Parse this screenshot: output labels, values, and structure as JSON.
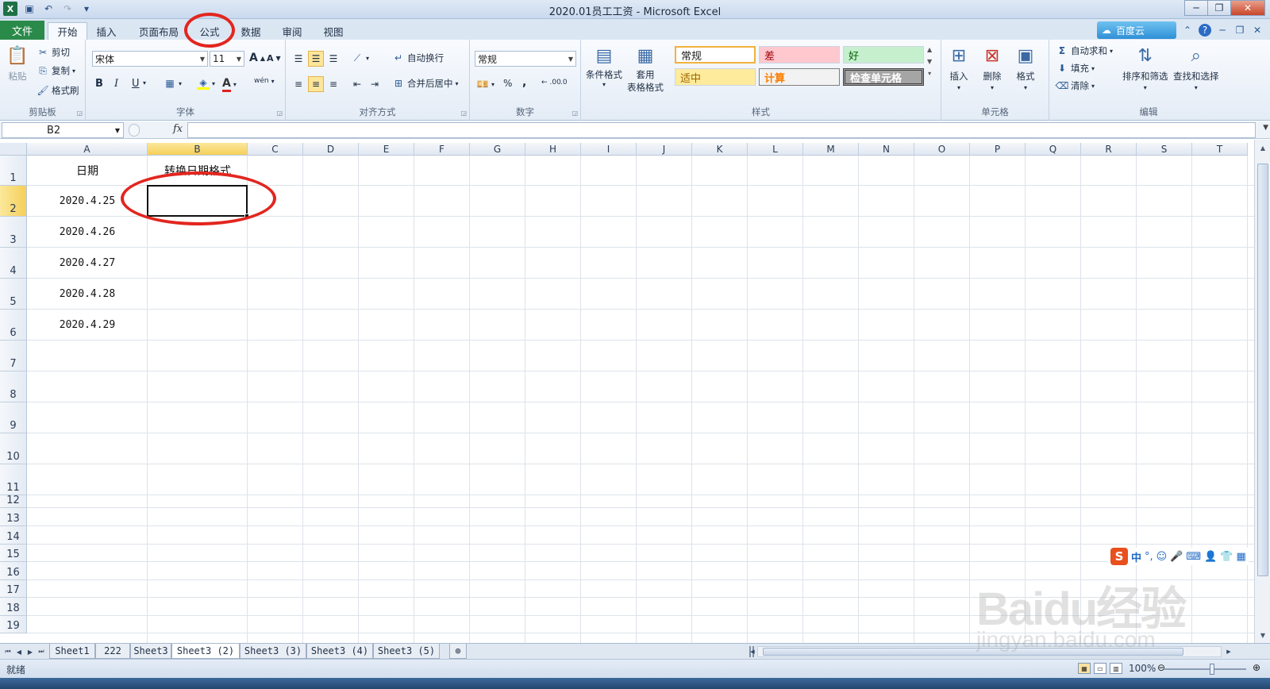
{
  "window": {
    "title": "2020.01员工工资 - Microsoft Excel",
    "controls": {
      "minimize": "─",
      "restore": "❐",
      "close": "✕"
    }
  },
  "ribbon_tabs": {
    "file": "文件",
    "tabs": [
      "开始",
      "插入",
      "页面布局",
      "公式",
      "数据",
      "审阅",
      "视图"
    ],
    "active": "开始",
    "cloud_label": "百度云"
  },
  "clipboard": {
    "paste": "粘贴",
    "cut": "剪切",
    "copy": "复制",
    "format_painter": "格式刷",
    "label": "剪贴板"
  },
  "font": {
    "name": "宋体",
    "size": "11",
    "bold": "B",
    "italic": "I",
    "underline": "U",
    "grow": "A",
    "shrink": "A",
    "color_a": "A",
    "wen": "wén",
    "label": "字体"
  },
  "alignment": {
    "wrap": "自动换行",
    "merge": "合并后居中",
    "label": "对齐方式"
  },
  "number": {
    "format": "常规",
    "percent": "%",
    "comma": ",",
    "inc_dec": ".00",
    "dec_dec": ".0",
    "label": "数字"
  },
  "styles": {
    "conditional": "条件格式",
    "table_format_1": "套用",
    "table_format_2": "表格格式",
    "normal": "常规",
    "bad": "差",
    "good": "好",
    "neutral": "适中",
    "calc": "计算",
    "check": "检查单元格",
    "label": "样式",
    "colors": {
      "normal": "#ffffff",
      "bad": "#ffc7ce",
      "good": "#c6efce",
      "neutral": "#ffeb9c",
      "calc": "#f2f2f2",
      "check": "#a5a5a5"
    }
  },
  "cells": {
    "insert": "插入",
    "delete": "删除",
    "format": "格式",
    "label": "单元格"
  },
  "editing": {
    "autosum": "自动求和",
    "fill": "填充",
    "clear": "清除",
    "sort": "排序和筛选",
    "find": "查找和选择",
    "label": "编辑"
  },
  "formula_bar": {
    "name_box": "B2",
    "fx": "fx",
    "value": ""
  },
  "grid": {
    "columns": [
      "A",
      "B",
      "C",
      "D",
      "E",
      "F",
      "G",
      "H",
      "I",
      "J",
      "K",
      "L",
      "M",
      "N",
      "O",
      "P",
      "Q",
      "R",
      "S",
      "T"
    ],
    "selected_col": "B",
    "rows": [
      "1",
      "2",
      "3",
      "4",
      "5",
      "6",
      "7",
      "8",
      "9",
      "10",
      "11",
      "12",
      "13",
      "14",
      "15",
      "16",
      "17",
      "18",
      "19"
    ],
    "selected_row": "2",
    "data": {
      "A1": "日期",
      "B1": "转换日期格式",
      "A2": "2020.4.25",
      "A3": "2020.4.26",
      "A4": "2020.4.27",
      "A5": "2020.4.28",
      "A6": "2020.4.29"
    }
  },
  "sheets": {
    "tabs": [
      "Sheet1",
      "222",
      "Sheet3",
      "Sheet3 (2)",
      "Sheet3 (3)",
      "Sheet3 (4)",
      "Sheet3 (5)"
    ],
    "active": "Sheet3 (2)"
  },
  "status": {
    "text": "就绪",
    "zoom": "100%"
  },
  "ime": {
    "logo": "S",
    "mode": "中"
  },
  "watermark": {
    "main": "Baidu经验",
    "sub": "jingyan.baidu.com"
  }
}
